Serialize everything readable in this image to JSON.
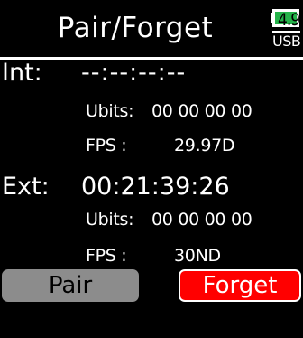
{
  "header": {
    "title": "Pair/Forget"
  },
  "battery": {
    "value": "4.9",
    "source": "USB",
    "fill_color": "#25b34a"
  },
  "internal": {
    "label": "Int:",
    "timecode": "--:--:--:--",
    "ubits_label": "Ubits:",
    "ubits_value": "00 00 00 00",
    "fps_label": "FPS :",
    "fps_value": "29.97D"
  },
  "external": {
    "label": "Ext:",
    "timecode": "00:21:39:26",
    "ubits_label": "Ubits:",
    "ubits_value": "00 00 00 00",
    "fps_label": "FPS :",
    "fps_value": "30ND"
  },
  "buttons": {
    "pair_label": "Pair",
    "forget_label": "Forget",
    "pair_color": "#8c8c8c",
    "forget_color": "#ff0000"
  }
}
